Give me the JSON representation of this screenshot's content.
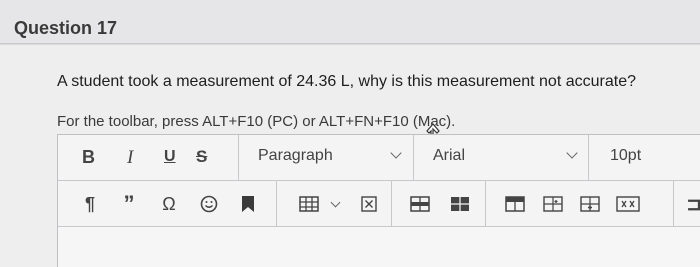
{
  "question": {
    "title": "Question 17",
    "text": "A student took a measurement of 24.36 L, why is this measurement not accurate?"
  },
  "editor": {
    "hint": "For the toolbar, press ALT+F10 (PC) or ALT+FN+F10 (Mac).",
    "toolbar_row1": {
      "bold": "B",
      "italic": "I",
      "underline": "U",
      "strikethrough": "S",
      "paragraph_select": "Paragraph",
      "font_select": "Arial",
      "size_select": "10pt"
    },
    "toolbar_row2_icons": [
      "pilcrow-icon",
      "quote-icon",
      "omega-icon",
      "emoji-icon",
      "bookmark-icon",
      "table-icon",
      "clear-formatting-icon",
      "table-row-icon",
      "table-header-icon",
      "table-cell-icon",
      "insert-column-icon",
      "insert-row-icon",
      "expand-icon"
    ]
  }
}
